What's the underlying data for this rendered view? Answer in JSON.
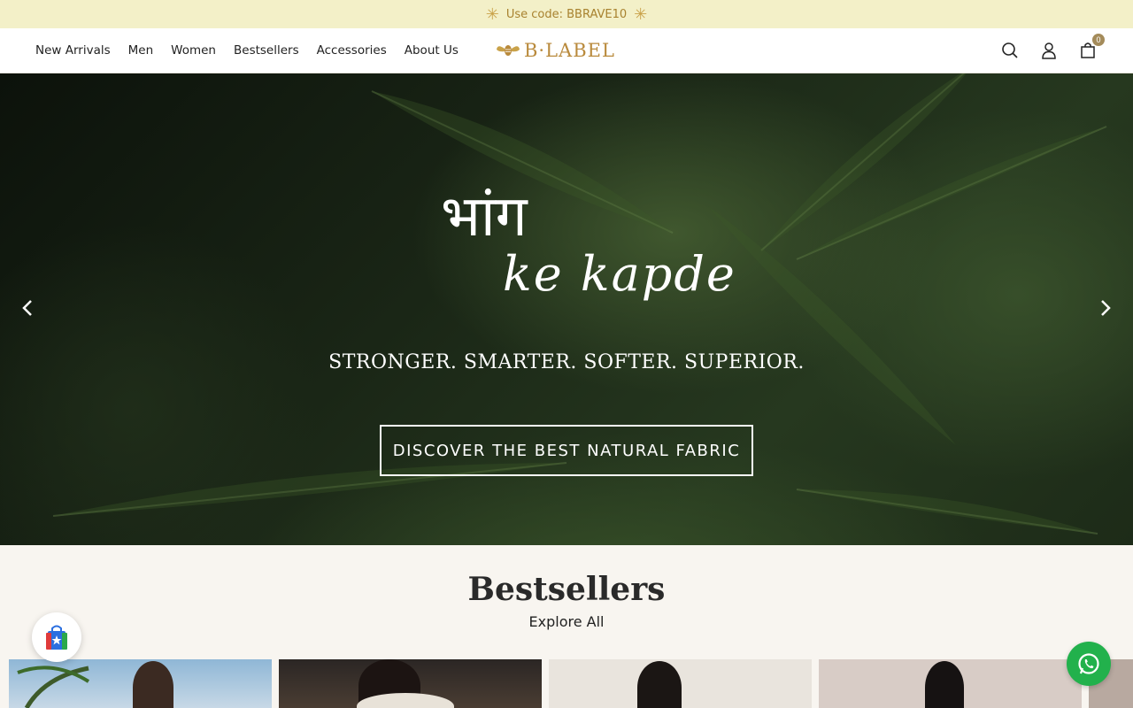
{
  "announcement": {
    "text": "Use code: BBRAVE10"
  },
  "header": {
    "logo_text": "B·LABEL",
    "nav": [
      "New Arrivals",
      "Men",
      "Women",
      "Bestsellers",
      "Accessories",
      "About Us"
    ],
    "icons": [
      "search-icon",
      "user-icon",
      "cart-icon"
    ],
    "cart_count": "0"
  },
  "hero": {
    "script_line1": "भांग",
    "script_line2": "ke kapde",
    "tagline": "STRONGER. SMARTER. SOFTER. SUPERIOR.",
    "cta": "DISCOVER THE BEST NATURAL FABRIC"
  },
  "bestsellers": {
    "title": "Bestsellers",
    "explore_label": "Explore All"
  },
  "colors": {
    "announce_bg": "#f3f0c8",
    "brand_gold": "#b98a3c",
    "whatsapp_green": "#22b14c"
  }
}
